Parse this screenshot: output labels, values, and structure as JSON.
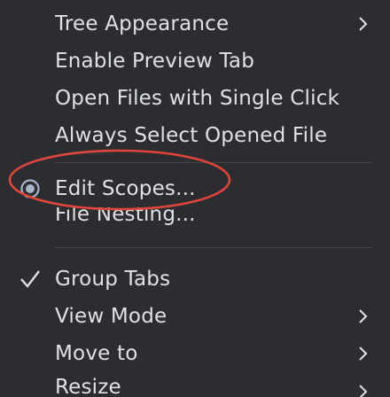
{
  "menu": {
    "items": [
      {
        "label": "Tree Appearance",
        "submenu": true
      },
      {
        "label": "Enable Preview Tab",
        "submenu": false
      },
      {
        "label": "Open Files with Single Click",
        "submenu": false
      },
      {
        "label": "Always Select Opened File",
        "submenu": false
      },
      {
        "label": "Edit Scopes...",
        "submenu": false,
        "marker": "radio-selected"
      },
      {
        "label": "File Nesting...",
        "submenu": false
      },
      {
        "label": "Group Tabs",
        "submenu": false,
        "checked": true
      },
      {
        "label": "View Mode",
        "submenu": true
      },
      {
        "label": "Move to",
        "submenu": true
      },
      {
        "label": "Resize",
        "submenu": true
      }
    ]
  },
  "colors": {
    "background": "#2b2d30",
    "text": "#dfe1e5",
    "separator": "#43454a",
    "annotation_ring": "#e0443a",
    "radio_accent": "#a8b4c8"
  }
}
